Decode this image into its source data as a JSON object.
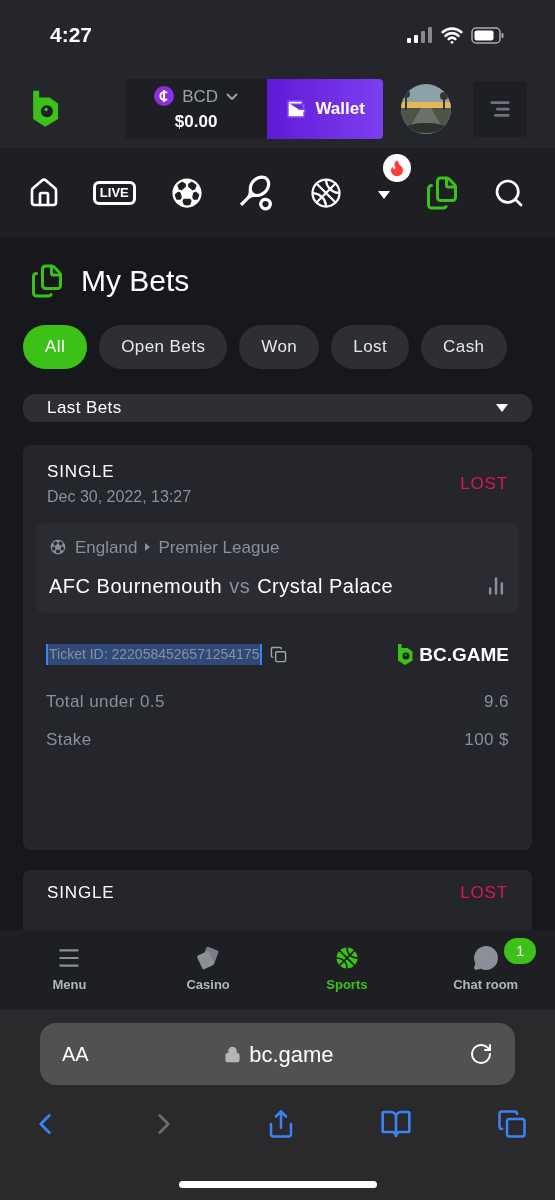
{
  "status_bar": {
    "time": "4:27"
  },
  "header": {
    "currency": "BCD",
    "balance": "$0.00",
    "wallet_button": "Wallet"
  },
  "sport_nav": [
    {
      "kind": "home",
      "selected": false
    },
    {
      "kind": "live",
      "label": "LIVE",
      "selected": false
    },
    {
      "kind": "soccer",
      "selected": false
    },
    {
      "kind": "tennis",
      "selected": false
    },
    {
      "kind": "basketball",
      "selected": false
    },
    {
      "kind": "more",
      "selected": false
    },
    {
      "kind": "bets",
      "selected": true
    },
    {
      "kind": "search",
      "selected": false
    }
  ],
  "page_title": "My Bets",
  "filters": [
    {
      "label": "All",
      "selected": true
    },
    {
      "label": "Open Bets",
      "selected": false
    },
    {
      "label": "Won",
      "selected": false
    },
    {
      "label": "Lost",
      "selected": false
    },
    {
      "label": "Cash",
      "selected": false
    }
  ],
  "period_select": {
    "value": "Last Bets"
  },
  "bets": [
    {
      "type": "SINGLE",
      "date": "Dec 30, 2022, 13:27",
      "result": "LOST",
      "country": "England",
      "league": "Premier League",
      "home": "AFC Bournemouth",
      "vs": "vs",
      "away": "Crystal Palace",
      "ticket_id": "Ticket ID: 2220584526571254175",
      "ticket_selected": true,
      "brand": "BC.GAME",
      "rows": [
        {
          "label": "Total under 0.5",
          "value": "9.6"
        },
        {
          "label": "Stake",
          "value": "100 $"
        }
      ]
    },
    {
      "type": "SINGLE",
      "result": "LOST"
    }
  ],
  "bottom_nav": [
    {
      "kind": "menu",
      "label": "Menu",
      "selected": false
    },
    {
      "kind": "casino",
      "label": "Casino",
      "selected": false
    },
    {
      "kind": "sports",
      "label": "Sports",
      "selected": true
    },
    {
      "kind": "chat",
      "label": "Chat room",
      "selected": false,
      "badge": "1"
    }
  ],
  "browser": {
    "text_size": "AA",
    "url": "bc.game",
    "back_enabled": true,
    "forward_enabled": false
  }
}
